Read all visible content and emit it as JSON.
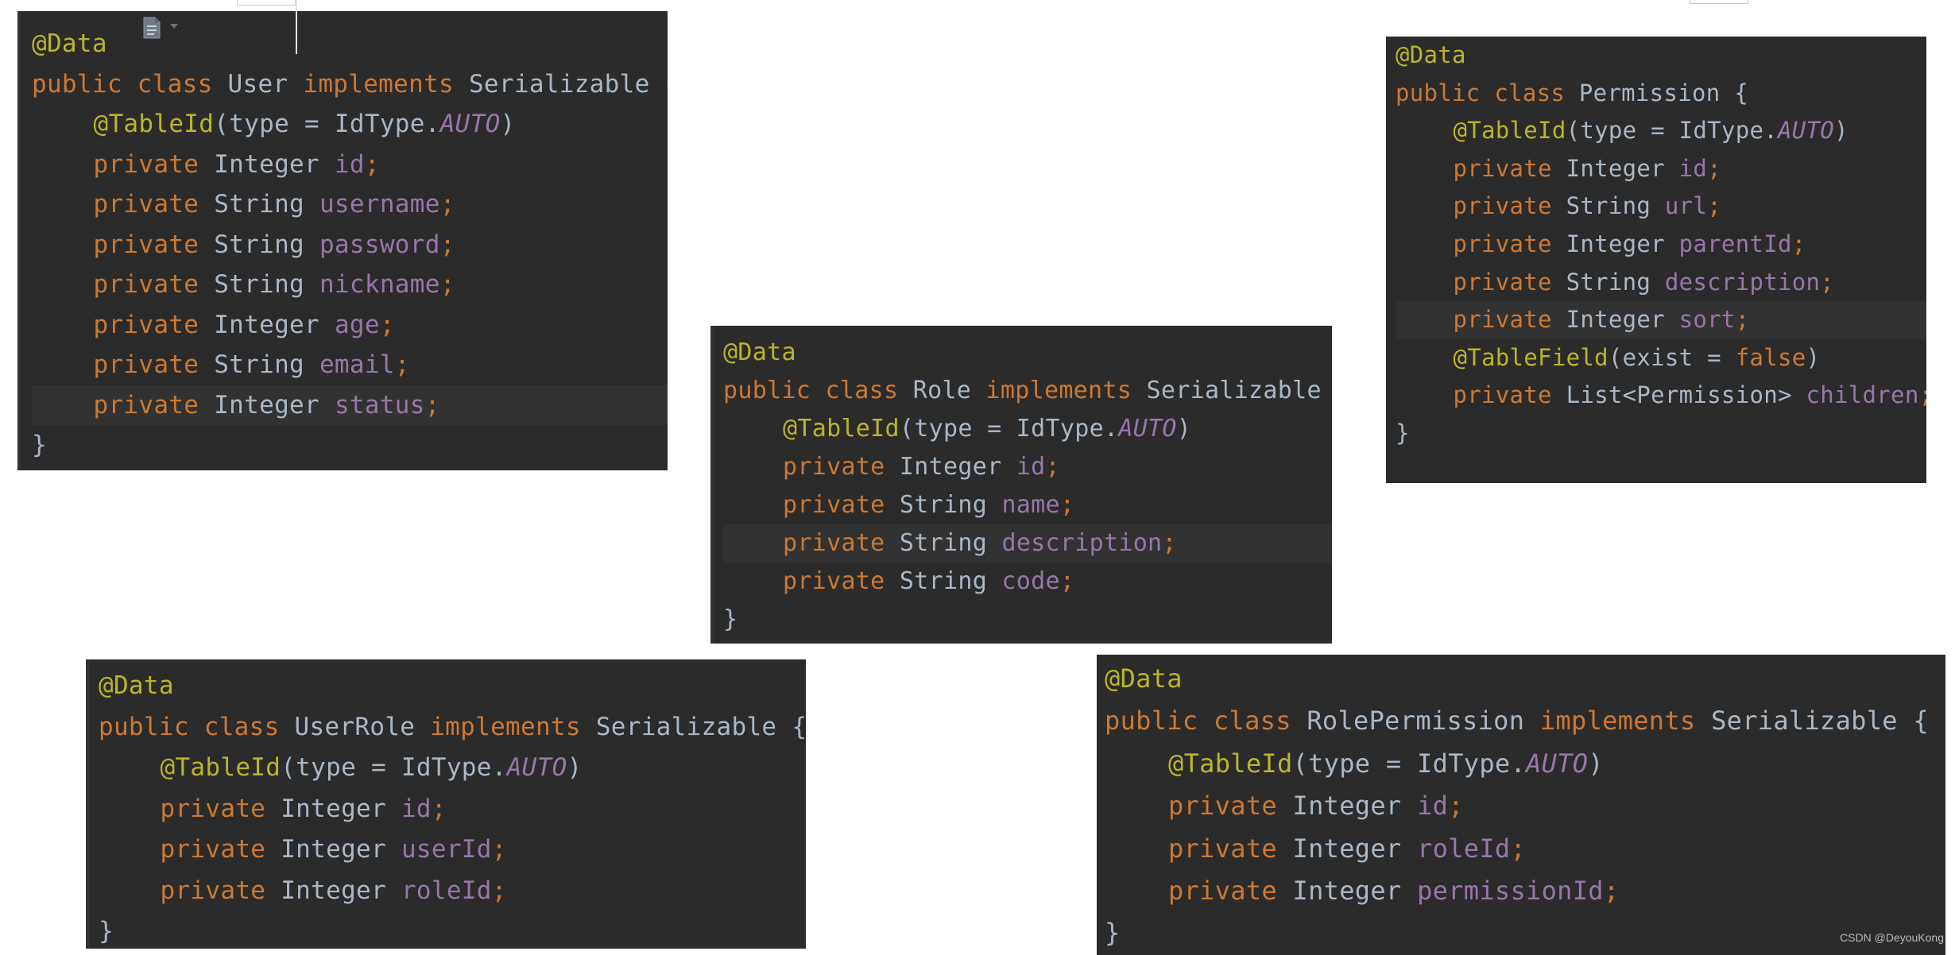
{
  "watermark": "CSDN @DeyouKong",
  "colors": {
    "editor_bg": "#2b2b2b",
    "current_line": "#323232",
    "annotation": "#bbb529",
    "keyword": "#cc7832",
    "type": "#a9b7c6",
    "field": "#9876aa"
  },
  "icons": {
    "file": "file-doc-icon",
    "caret": "chevron-down-icon"
  },
  "panels": {
    "user": {
      "lines": [
        [
          {
            "t": "annot",
            "v": "@Data"
          }
        ],
        [
          {
            "t": "kw",
            "v": "public class "
          },
          {
            "t": "type",
            "v": "User "
          },
          {
            "t": "kw",
            "v": "implements "
          },
          {
            "t": "type",
            "v": "Serializable {"
          }
        ],
        [
          {
            "t": "annot",
            "v": "@TableId"
          },
          {
            "t": "plain",
            "v": "(type = IdType."
          },
          {
            "t": "const",
            "v": "AUTO"
          },
          {
            "t": "plain",
            "v": ")"
          }
        ],
        [
          {
            "t": "kw",
            "v": "private "
          },
          {
            "t": "type",
            "v": "Integer "
          },
          {
            "t": "field",
            "v": "id"
          },
          {
            "t": "kw",
            "v": ";"
          }
        ],
        [
          {
            "t": "kw",
            "v": "private "
          },
          {
            "t": "type",
            "v": "String "
          },
          {
            "t": "field",
            "v": "username"
          },
          {
            "t": "kw",
            "v": ";"
          }
        ],
        [
          {
            "t": "kw",
            "v": "private "
          },
          {
            "t": "type",
            "v": "String "
          },
          {
            "t": "field",
            "v": "password"
          },
          {
            "t": "kw",
            "v": ";"
          }
        ],
        [
          {
            "t": "kw",
            "v": "private "
          },
          {
            "t": "type",
            "v": "String "
          },
          {
            "t": "field",
            "v": "nickname"
          },
          {
            "t": "kw",
            "v": ";"
          }
        ],
        [
          {
            "t": "kw",
            "v": "private "
          },
          {
            "t": "type",
            "v": "Integer "
          },
          {
            "t": "field",
            "v": "age"
          },
          {
            "t": "kw",
            "v": ";"
          }
        ],
        [
          {
            "t": "kw",
            "v": "private "
          },
          {
            "t": "type",
            "v": "String "
          },
          {
            "t": "field",
            "v": "email"
          },
          {
            "t": "kw",
            "v": ";"
          }
        ],
        [
          {
            "t": "kw",
            "v": "private "
          },
          {
            "t": "type",
            "v": "Integer "
          },
          {
            "t": "field",
            "v": "status"
          },
          {
            "t": "kw",
            "v": ";"
          }
        ],
        [
          {
            "t": "plain",
            "v": "}"
          }
        ]
      ],
      "indent": [
        false,
        false,
        true,
        true,
        true,
        true,
        true,
        true,
        true,
        true,
        false
      ],
      "current": 9
    },
    "role": {
      "lines": [
        [
          {
            "t": "annot",
            "v": "@Data"
          }
        ],
        [
          {
            "t": "kw",
            "v": "public class "
          },
          {
            "t": "type",
            "v": "Role "
          },
          {
            "t": "kw",
            "v": "implements "
          },
          {
            "t": "type",
            "v": "Serializable {"
          }
        ],
        [
          {
            "t": "annot",
            "v": "@TableId"
          },
          {
            "t": "plain",
            "v": "(type = IdType."
          },
          {
            "t": "const",
            "v": "AUTO"
          },
          {
            "t": "plain",
            "v": ")"
          }
        ],
        [
          {
            "t": "kw",
            "v": "private "
          },
          {
            "t": "type",
            "v": "Integer "
          },
          {
            "t": "field",
            "v": "id"
          },
          {
            "t": "kw",
            "v": ";"
          }
        ],
        [
          {
            "t": "kw",
            "v": "private "
          },
          {
            "t": "type",
            "v": "String "
          },
          {
            "t": "field",
            "v": "name"
          },
          {
            "t": "kw",
            "v": ";"
          }
        ],
        [
          {
            "t": "kw",
            "v": "private "
          },
          {
            "t": "type",
            "v": "String "
          },
          {
            "t": "field",
            "v": "description"
          },
          {
            "t": "kw",
            "v": ";"
          }
        ],
        [
          {
            "t": "kw",
            "v": "private "
          },
          {
            "t": "type",
            "v": "String "
          },
          {
            "t": "field",
            "v": "code"
          },
          {
            "t": "kw",
            "v": ";"
          }
        ],
        [
          {
            "t": "plain",
            "v": "}"
          }
        ]
      ],
      "indent": [
        false,
        false,
        true,
        true,
        true,
        true,
        true,
        false
      ],
      "current": 5
    },
    "permission": {
      "lines": [
        [
          {
            "t": "annot",
            "v": "@Data"
          }
        ],
        [
          {
            "t": "kw",
            "v": "public class "
          },
          {
            "t": "type",
            "v": "Permission {"
          }
        ],
        [
          {
            "t": "annot",
            "v": "@TableId"
          },
          {
            "t": "plain",
            "v": "(type = IdType."
          },
          {
            "t": "const",
            "v": "AUTO"
          },
          {
            "t": "plain",
            "v": ")"
          }
        ],
        [
          {
            "t": "kw",
            "v": "private "
          },
          {
            "t": "type",
            "v": "Integer "
          },
          {
            "t": "field",
            "v": "id"
          },
          {
            "t": "kw",
            "v": ";"
          }
        ],
        [
          {
            "t": "kw",
            "v": "private "
          },
          {
            "t": "type",
            "v": "String "
          },
          {
            "t": "field",
            "v": "url"
          },
          {
            "t": "kw",
            "v": ";"
          }
        ],
        [
          {
            "t": "kw",
            "v": "private "
          },
          {
            "t": "type",
            "v": "Integer "
          },
          {
            "t": "field",
            "v": "parentId"
          },
          {
            "t": "kw",
            "v": ";"
          }
        ],
        [
          {
            "t": "kw",
            "v": "private "
          },
          {
            "t": "type",
            "v": "String "
          },
          {
            "t": "field",
            "v": "description"
          },
          {
            "t": "kw",
            "v": ";"
          }
        ],
        [
          {
            "t": "kw",
            "v": "private "
          },
          {
            "t": "type",
            "v": "Integer "
          },
          {
            "t": "field",
            "v": "sort"
          },
          {
            "t": "kw",
            "v": ";"
          }
        ],
        [
          {
            "t": "annot",
            "v": "@TableField"
          },
          {
            "t": "plain",
            "v": "(exist = "
          },
          {
            "t": "kwlit",
            "v": "false"
          },
          {
            "t": "plain",
            "v": ")"
          }
        ],
        [
          {
            "t": "kw",
            "v": "private "
          },
          {
            "t": "type",
            "v": "List<Permission> "
          },
          {
            "t": "field",
            "v": "children"
          },
          {
            "t": "kw",
            "v": ";"
          }
        ],
        [
          {
            "t": "plain",
            "v": "}"
          }
        ]
      ],
      "indent": [
        false,
        false,
        true,
        true,
        true,
        true,
        true,
        true,
        true,
        true,
        false
      ],
      "current": 7
    },
    "userrole": {
      "lines": [
        [
          {
            "t": "annot",
            "v": "@Data"
          }
        ],
        [
          {
            "t": "kw",
            "v": "public class "
          },
          {
            "t": "type",
            "v": "UserRole "
          },
          {
            "t": "kw",
            "v": "implements "
          },
          {
            "t": "type",
            "v": "Serializable {"
          }
        ],
        [
          {
            "t": "annot",
            "v": "@TableId"
          },
          {
            "t": "plain",
            "v": "(type = IdType."
          },
          {
            "t": "const",
            "v": "AUTO"
          },
          {
            "t": "plain",
            "v": ")"
          }
        ],
        [
          {
            "t": "kw",
            "v": "private "
          },
          {
            "t": "type",
            "v": "Integer "
          },
          {
            "t": "field",
            "v": "id"
          },
          {
            "t": "kw",
            "v": ";"
          }
        ],
        [
          {
            "t": "kw",
            "v": "private "
          },
          {
            "t": "type",
            "v": "Integer "
          },
          {
            "t": "field",
            "v": "userId"
          },
          {
            "t": "kw",
            "v": ";"
          }
        ],
        [
          {
            "t": "kw",
            "v": "private "
          },
          {
            "t": "type",
            "v": "Integer "
          },
          {
            "t": "field",
            "v": "roleId"
          },
          {
            "t": "kw",
            "v": ";"
          }
        ],
        [
          {
            "t": "plain",
            "v": "}"
          }
        ]
      ],
      "indent": [
        false,
        false,
        true,
        true,
        true,
        true,
        false
      ],
      "current": -1
    },
    "rolepermission": {
      "lines": [
        [
          {
            "t": "annot",
            "v": "@Data"
          }
        ],
        [
          {
            "t": "kw",
            "v": "public class "
          },
          {
            "t": "type",
            "v": "RolePermission "
          },
          {
            "t": "kw",
            "v": "implements "
          },
          {
            "t": "type",
            "v": "Serializable {"
          }
        ],
        [
          {
            "t": "annot",
            "v": "@TableId"
          },
          {
            "t": "plain",
            "v": "(type = IdType."
          },
          {
            "t": "const",
            "v": "AUTO"
          },
          {
            "t": "plain",
            "v": ")"
          }
        ],
        [
          {
            "t": "kw",
            "v": "private "
          },
          {
            "t": "type",
            "v": "Integer "
          },
          {
            "t": "field",
            "v": "id"
          },
          {
            "t": "kw",
            "v": ";"
          }
        ],
        [
          {
            "t": "kw",
            "v": "private "
          },
          {
            "t": "type",
            "v": "Integer "
          },
          {
            "t": "field",
            "v": "roleId"
          },
          {
            "t": "kw",
            "v": ";"
          }
        ],
        [
          {
            "t": "kw",
            "v": "private "
          },
          {
            "t": "type",
            "v": "Integer "
          },
          {
            "t": "field",
            "v": "permissionId"
          },
          {
            "t": "kw",
            "v": ";"
          }
        ],
        [
          {
            "t": "plain",
            "v": "}"
          }
        ]
      ],
      "indent": [
        false,
        false,
        true,
        true,
        true,
        true,
        false
      ],
      "current": -1
    }
  }
}
